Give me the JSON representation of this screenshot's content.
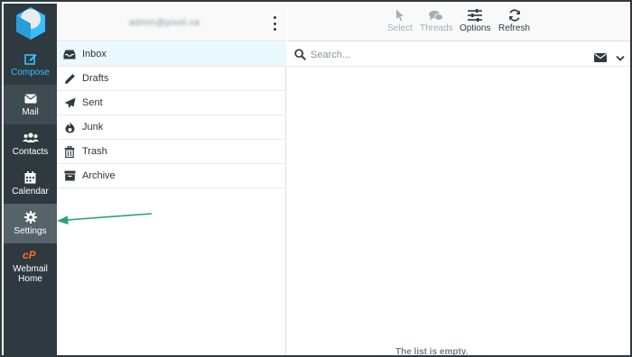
{
  "nav": {
    "compose": "Compose",
    "mail": "Mail",
    "contacts": "Contacts",
    "calendar": "Calendar",
    "settings": "Settings",
    "webmail_line1": "Webmail",
    "webmail_line2": "Home"
  },
  "account": {
    "username": "admin@pixel.ca"
  },
  "folders": [
    {
      "label": "Inbox",
      "icon": "inbox-icon"
    },
    {
      "label": "Drafts",
      "icon": "pencil-icon"
    },
    {
      "label": "Sent",
      "icon": "paper-plane-icon"
    },
    {
      "label": "Junk",
      "icon": "fire-icon"
    },
    {
      "label": "Trash",
      "icon": "trash-icon"
    },
    {
      "label": "Archive",
      "icon": "archive-box-icon"
    }
  ],
  "toolbar": {
    "select": "Select",
    "threads": "Threads",
    "options": "Options",
    "refresh": "Refresh"
  },
  "search": {
    "placeholder": "Search..."
  },
  "list": {
    "empty_message": "The list is empty."
  },
  "colors": {
    "nav_bg": "#2f3a40",
    "accent": "#37beff",
    "cpanel_orange": "#ff6c2c",
    "arrow": "#2aa36b"
  }
}
